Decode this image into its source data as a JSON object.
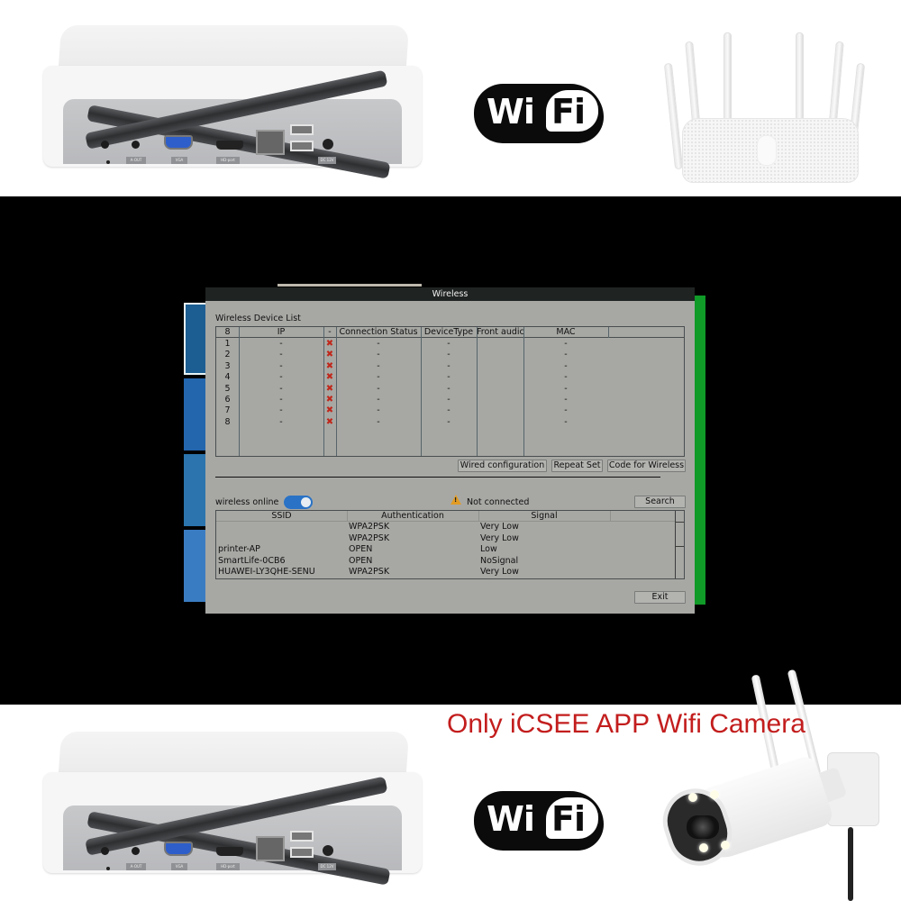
{
  "product_banner": {
    "nvr_port_labels": [
      "A-OUT",
      "VGA",
      "HD-port",
      "DC 12V"
    ],
    "wifi_logo": {
      "left": "Wi",
      "right": "Fi"
    },
    "promo_text": "Only iCSEE APP Wifi Camera",
    "promo_color": "#c31d1d"
  },
  "dialog": {
    "title": "Wireless",
    "device_list": {
      "label": "Wireless Device List",
      "columns": [
        "8",
        "IP",
        "-",
        "Connection Status",
        "DeviceType",
        "Front audic",
        "MAC",
        ""
      ],
      "rows": [
        {
          "no": "1",
          "ip": "-",
          "status_icon": "x-icon",
          "conn": "-",
          "type": "-",
          "mac": "-"
        },
        {
          "no": "2",
          "ip": "-",
          "status_icon": "x-icon",
          "conn": "-",
          "type": "-",
          "mac": "-"
        },
        {
          "no": "3",
          "ip": "-",
          "status_icon": "x-icon",
          "conn": "-",
          "type": "-",
          "mac": "-"
        },
        {
          "no": "4",
          "ip": "-",
          "status_icon": "x-icon",
          "conn": "-",
          "type": "-",
          "mac": "-"
        },
        {
          "no": "5",
          "ip": "-",
          "status_icon": "x-icon",
          "conn": "-",
          "type": "-",
          "mac": "-"
        },
        {
          "no": "6",
          "ip": "-",
          "status_icon": "x-icon",
          "conn": "-",
          "type": "-",
          "mac": "-"
        },
        {
          "no": "7",
          "ip": "-",
          "status_icon": "x-icon",
          "conn": "-",
          "type": "-",
          "mac": "-"
        },
        {
          "no": "8",
          "ip": "-",
          "status_icon": "x-icon",
          "conn": "-",
          "type": "-",
          "mac": "-"
        }
      ]
    },
    "buttons": {
      "wired_configuration": "Wired configuration",
      "repeat_set": "Repeat Set",
      "code_for_wireless": "Code for Wireless",
      "search": "Search",
      "exit": "Exit"
    },
    "wireless_online": {
      "label": "wireless online",
      "enabled": true
    },
    "connection_status": {
      "icon": "warning-icon",
      "text": "Not connected"
    },
    "ssid_list": {
      "columns": [
        "SSID",
        "Authentication",
        "Signal",
        ""
      ],
      "rows": [
        {
          "ssid": "",
          "auth": "WPA2PSK",
          "signal": "Very Low"
        },
        {
          "ssid": "",
          "auth": "WPA2PSK",
          "signal": "Very Low"
        },
        {
          "ssid": "printer-AP",
          "auth": "OPEN",
          "signal": "Low"
        },
        {
          "ssid": "SmartLife-0CB6",
          "auth": "OPEN",
          "signal": "NoSignal"
        },
        {
          "ssid": "HUAWEI-LY3QHE-SENU",
          "auth": "WPA2PSK",
          "signal": "Very Low"
        }
      ]
    }
  },
  "colors": {
    "dialog_bg": "#a7a8a4",
    "title_bar": "#1f2322",
    "accent_green": "#109a28",
    "toggle_blue": "#2a72c6",
    "x_red": "#c0271b",
    "warning_orange": "#e29c24"
  }
}
